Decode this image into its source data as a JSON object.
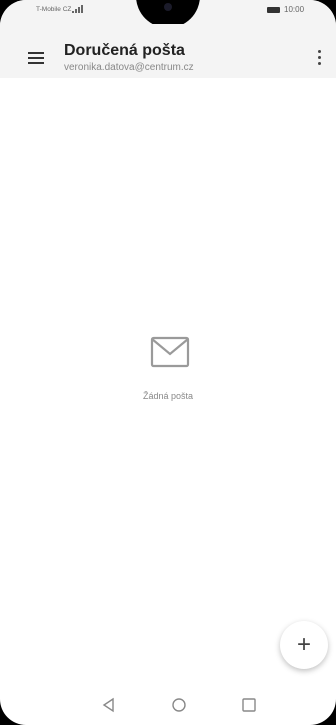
{
  "status_bar": {
    "carrier": "T-Mobile CZ",
    "time": "10:00"
  },
  "app_bar": {
    "title": "Doručená pošta",
    "account": "veronika.datova@centrum.cz"
  },
  "empty_state": {
    "message": "Žádná pošta",
    "icon": "envelope-icon"
  },
  "fab": {
    "label": "+",
    "icon": "add-icon"
  },
  "nav_bar": {
    "icons": [
      "back-icon",
      "home-icon",
      "recents-icon"
    ]
  }
}
